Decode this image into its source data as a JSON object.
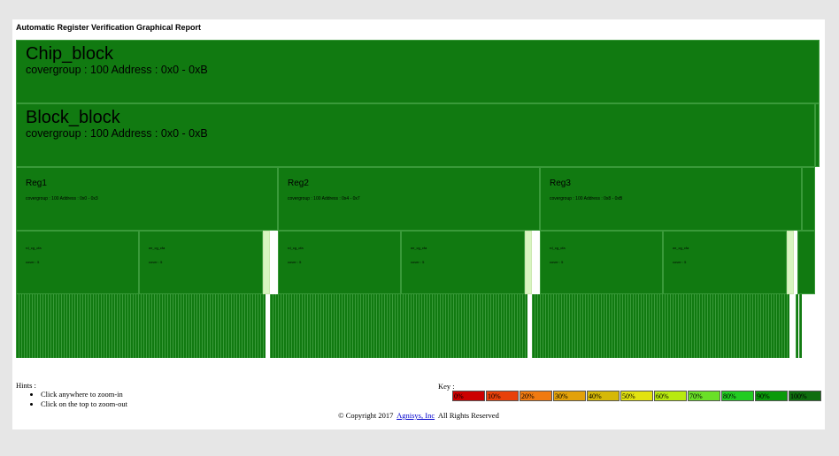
{
  "report_title": "Automatic Register Verification Graphical Report",
  "treemap": {
    "chip": {
      "name": "Chip_block",
      "info": "covergroup : 100 Address : 0x0 - 0xB",
      "coverage_pct": 100
    },
    "block": {
      "name": "Block_block",
      "info": "covergroup : 100 Address : 0x0 - 0xB",
      "coverage_pct": 100
    },
    "registers": [
      {
        "name": "Reg1",
        "info": "covergroup : 100 Address : 0x0 - 0x3",
        "fields": [
          {
            "name": "rd_cg_cfa",
            "info": "cover : 5"
          },
          {
            "name": "wr_cg_cfa",
            "info": "cover : 5"
          }
        ]
      },
      {
        "name": "Reg2",
        "info": "covergroup : 100 Address : 0x4 - 0x7",
        "fields": [
          {
            "name": "rd_cg_cfa",
            "info": "cover : 5"
          },
          {
            "name": "wr_cg_cfa",
            "info": "cover : 5"
          }
        ]
      },
      {
        "name": "Reg3",
        "info": "covergroup : 100 Address : 0x8 - 0xB",
        "fields": [
          {
            "name": "rd_cg_cfa",
            "info": "cover : 5"
          },
          {
            "name": "wr_cg_cfa",
            "info": "cover : 5"
          }
        ]
      }
    ]
  },
  "hints": {
    "label": "Hints :",
    "items": [
      "Click anywhere to zoom-in",
      "Click on the top to zoom-out"
    ]
  },
  "key": {
    "label": "Key :",
    "items": [
      {
        "label": "0%",
        "color": "#cc0000"
      },
      {
        "label": "10%",
        "color": "#e8400a"
      },
      {
        "label": "20%",
        "color": "#f07a10"
      },
      {
        "label": "30%",
        "color": "#e2a10a"
      },
      {
        "label": "40%",
        "color": "#d6b808"
      },
      {
        "label": "50%",
        "color": "#e2e210"
      },
      {
        "label": "60%",
        "color": "#b8ea10"
      },
      {
        "label": "70%",
        "color": "#6ae028"
      },
      {
        "label": "80%",
        "color": "#22cc22"
      },
      {
        "label": "90%",
        "color": "#0a9a0a"
      },
      {
        "label": "100%",
        "color": "#0f6e0f"
      }
    ]
  },
  "copyright": {
    "prefix": "© Copyright 2017",
    "link_text": "Agnisys, Inc",
    "suffix": "All Rights Reserved"
  }
}
